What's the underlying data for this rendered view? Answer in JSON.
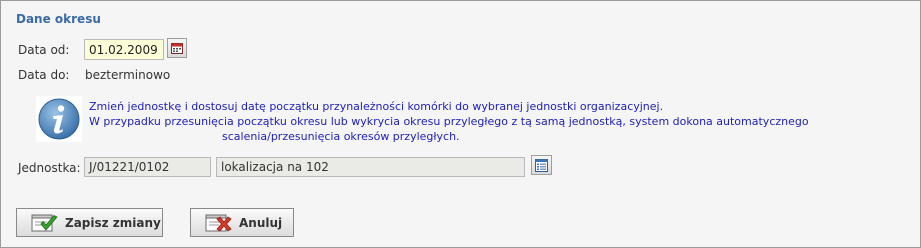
{
  "section": {
    "title": "Dane okresu"
  },
  "date_from": {
    "label": "Data od:",
    "value": "01.02.2009",
    "button_icon": "calendar-icon"
  },
  "date_to": {
    "label": "Data do:",
    "value": "bezterminowo"
  },
  "info": {
    "icon": "info-icon",
    "line1": "Zmień jednostkę i dostosuj datę początku przynależności komórki do wybranej jednostki organizacyjnej.",
    "line2": "W przypadku przesunięcia początku okresu lub wykrycia okresu przyległego z tą samą jednostką, system dokona automatycznego",
    "line3": "scalenia/przesunięcia okresów przyległych.",
    "text_color": "#2121b7"
  },
  "unit": {
    "label": "Jednostka:",
    "code": "J/01221/0102",
    "name": "lokalizacja na 102",
    "button_icon": "list-icon"
  },
  "actions": {
    "save_label": "Zapisz zmiany",
    "save_icon": "save-check-icon",
    "cancel_label": "Anuluj",
    "cancel_icon": "cancel-x-icon"
  },
  "colors": {
    "title": "#3b6aa8",
    "date_input_bg": "#fdfdd8",
    "readonly_bg": "#eaeae6",
    "panel_bg": "#f5f5f5"
  }
}
